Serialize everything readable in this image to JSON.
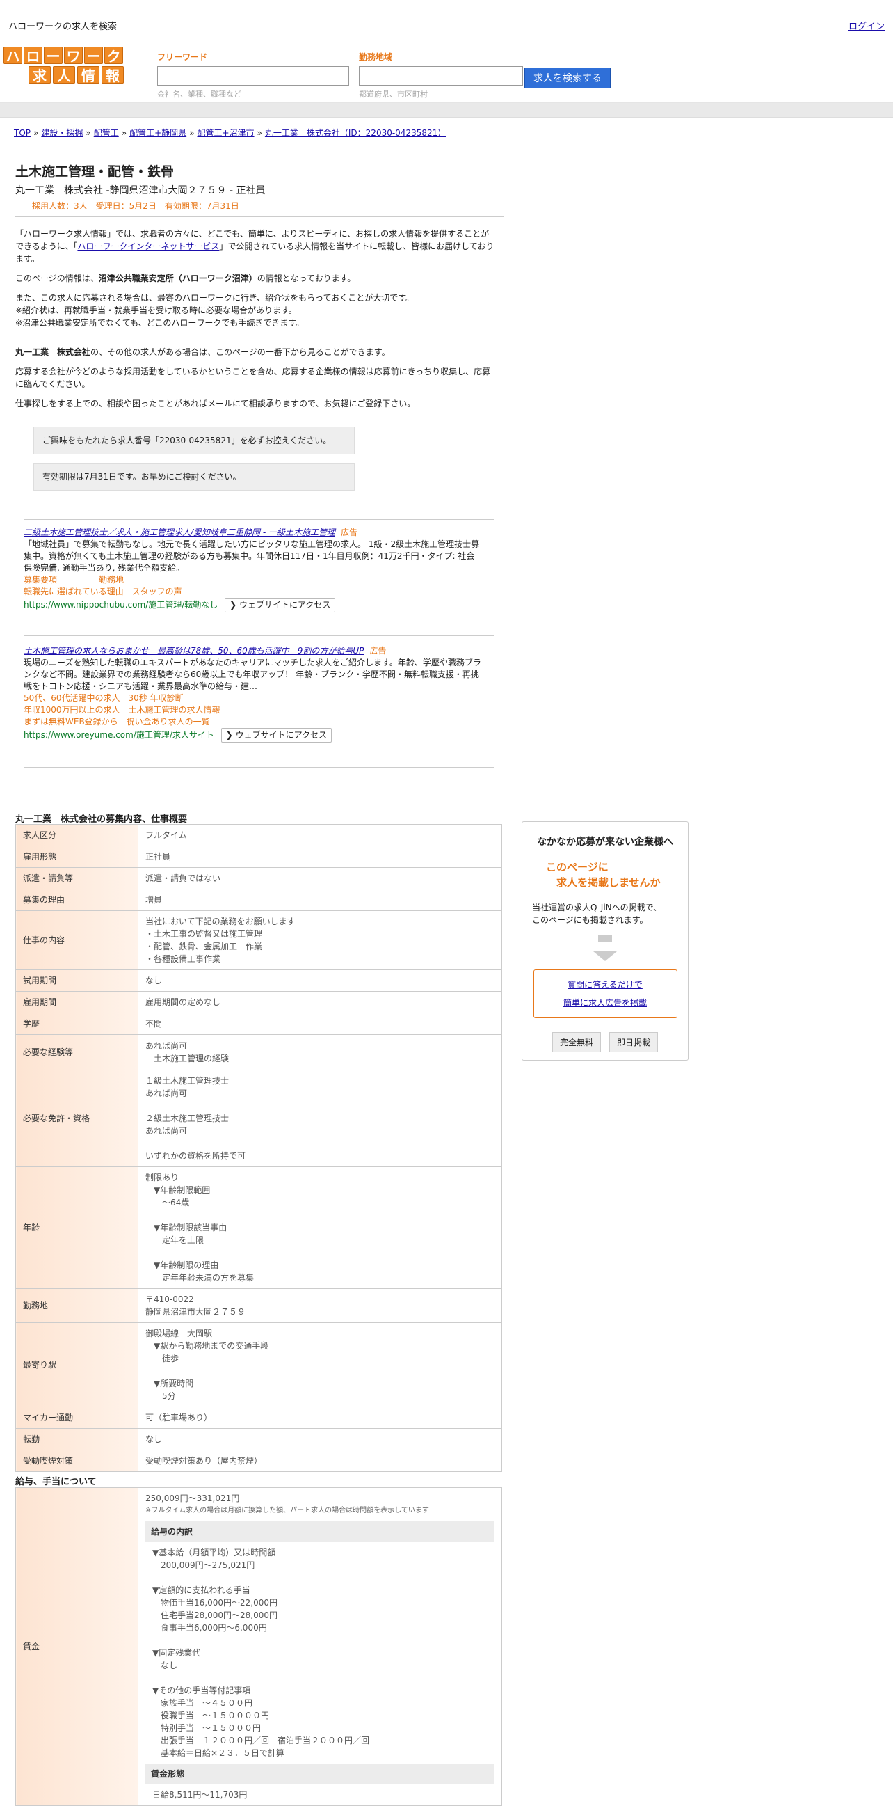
{
  "topbar": {
    "title": "ハローワークの求人を検索",
    "login": "ログイン"
  },
  "logo": {
    "row1": [
      "ハ",
      "ロ",
      "ー",
      "ワ",
      "ー",
      "ク"
    ],
    "row2": [
      "求",
      "人",
      "情",
      "報"
    ]
  },
  "search": {
    "free_label": "フリーワード",
    "free_placeholder": "会社名、業種、職種など",
    "area_label": "勤務地域",
    "area_placeholder": "都道府県、市区町村",
    "button": "求人を検索する"
  },
  "breadcrumb": [
    "TOP",
    "建設・採掘",
    "配管工",
    "配管工+静岡県",
    "配管工+沼津市",
    "丸一工業　株式会社（ID：22030-04235821）"
  ],
  "job": {
    "title": "土木施工管理・配管・鉄骨",
    "company_line": "丸一工業　株式会社 -静岡県沼津市大岡２７５９ - 正社員",
    "meta": "採用人数：3人　受理日：5月2日　有効期限：7月31日"
  },
  "intro": {
    "p1a": "「ハローワーク求人情報」では、求職者の方々に、どこでも、簡単に、よりスピーディに、お探しの求人情報を提供することができるように、「",
    "p1link": "ハローワークインターネットサービス",
    "p1b": "」で公開されている求人情報を当サイトに転載し、皆様にお届けしております。",
    "p2a": "このページの情報は、",
    "p2b": "沼津公共職業安定所（ハローワーク沼津）",
    "p2c": "の情報となっております。",
    "p3": "また、この求人に応募される場合は、最寄のハローワークに行き、紹介状をもらっておくことが大切です。",
    "p3b": "※紹介状は、再就職手当・就業手当を受け取る時に必要な場合があります。",
    "p3c": "※沼津公共職業安定所でなくても、どこのハローワークでも手続きできます。",
    "p4a": "丸一工業　株式会社",
    "p4b": "の、その他の求人がある場合は、このページの一番下から見ることができます。",
    "p5": "応募する会社が今どのような採用活動をしているかということを含め、応募する企業様の情報は応募前にきっちり収集し、応募に臨んでください。",
    "p6": "仕事探しをする上での、相談や困ったことがあればメールにて相談承りますので、お気軽にご登録下さい。",
    "notice1": "ご興味をもたれたら求人番号「22030-04235821」を必ずお控えください。",
    "notice2": "有効期限は7月31日です。お早めにご検討ください。"
  },
  "ads": [
    {
      "title": "二級土木施工管理技士／求人・施工管理求人/愛知岐阜三重静岡 - 一級土木施工管理",
      "label": "広告",
      "desc": "「地域社員」で募集で転勤もなし。地元で長く活躍したい方にピッタリな施工管理の求人。 1級・2級土木施工管理技士募集中。資格が無くても土木施工管理の経験がある方も募集中。年間休日117日・1年目月収例：41万2千円・タイプ: 社会保険完備, 通勤手当あり, 残業代全額支給。",
      "sitelinks1": "募集要項　　　　　勤務地",
      "sitelinks2": "転職先に選ばれている理由　スタッフの声",
      "url": "https://www.nippochubu.com/施工管理/転勤なし",
      "button": "ウェブサイトにアクセス"
    },
    {
      "title": "土木施工管理の求人ならおまかせ - 最高齢は78歳、50、60歳も活躍中 - 9割の方が給与UP",
      "label": "広告",
      "desc": "現場のニーズを熟知した転職のエキスパートがあなたのキャリアにマッチした求人をご紹介します。年齢、学歴や職務ブランクなど不問。建設業界での業務経験者なら60歳以上でも年収アップ！ 年齢・ブランク・学歴不問・無料転職支援・再挑戦をトコトン応援・シニアも活躍・業界最高水準の給与・建…",
      "sitelinks1": "50代、60代活躍中の求人　30秒 年収診断",
      "sitelinks2": "年収1000万円以上の求人　土木施工管理の求人情報",
      "sitelinks3": "まずは無料WEB登録から　祝い金あり求人の一覧",
      "url": "https://www.oreyume.com/施工管理/求人サイト",
      "button": "ウェブサイトにアクセス"
    }
  ],
  "section1_title": "丸一工業　株式会社の募集内容、仕事概要",
  "table1": [
    {
      "k": "求人区分",
      "v": [
        "フルタイム"
      ]
    },
    {
      "k": "雇用形態",
      "v": [
        "正社員"
      ]
    },
    {
      "k": "派遣・請負等",
      "v": [
        "派遣・請負ではない"
      ]
    },
    {
      "k": "募集の理由",
      "v": [
        "増員"
      ]
    },
    {
      "k": "仕事の内容",
      "v": [
        "当社において下記の業務をお願いします",
        "・土木工事の監督又は施工管理",
        "・配管、鉄骨、金属加工　作業",
        "・各種設備工事作業"
      ]
    },
    {
      "k": "試用期間",
      "v": [
        "なし"
      ]
    },
    {
      "k": "雇用期間",
      "v": [
        "雇用期間の定めなし"
      ]
    },
    {
      "k": "学歴",
      "v": [
        "不問"
      ]
    },
    {
      "k": "必要な経験等",
      "v": [
        "あれば尚可",
        "　土木施工管理の経験"
      ]
    },
    {
      "k": "必要な免許・資格",
      "v": [
        "１級土木施工管理技士",
        "あれば尚可",
        "",
        "２級土木施工管理技士",
        "あれば尚可",
        "",
        "いずれかの資格を所持で可"
      ]
    },
    {
      "k": "年齢",
      "v": [
        "制限あり",
        "　▼年齢制限範囲",
        "　　〜64歳",
        "",
        "　▼年齢制限該当事由",
        "　　定年を上限",
        "",
        "　▼年齢制限の理由",
        "　　定年年齢未満の方を募集"
      ]
    },
    {
      "k": "勤務地",
      "v": [
        "〒410-0022",
        "静岡県沼津市大岡２７５９"
      ]
    },
    {
      "k": "最寄り駅",
      "v": [
        "御殿場線　大岡駅",
        "　▼駅から勤務地までの交通手段",
        "　　徒歩",
        "",
        "　▼所要時間",
        "　　5分"
      ]
    },
    {
      "k": "マイカー通勤",
      "v": [
        "可（駐車場あり）"
      ]
    },
    {
      "k": "転勤",
      "v": [
        "なし"
      ]
    },
    {
      "k": "受動喫煙対策",
      "v": [
        "受動喫煙対策あり（屋内禁煙）"
      ]
    }
  ],
  "section2_title": "給与、手当について",
  "wage": {
    "key": "賃金",
    "range": "250,009円〜331,021円",
    "note": "※フルタイム求人の場合は月額に換算した額、パート求人の場合は時間額を表示しています",
    "sub1": "給与の内訳",
    "lines1": [
      "▼基本給（月額平均）又は時間額",
      "　200,009円〜275,021円",
      "",
      "▼定額的に支払われる手当",
      "　物価手当16,000円〜22,000円",
      "　住宅手当28,000円〜28,000円",
      "　食事手当6,000円〜6,000円",
      "",
      "▼固定残業代",
      "　なし",
      "",
      "▼その他の手当等付記事項",
      "　家族手当　〜４５００円",
      "　役職手当　〜１５００００円",
      "　特別手当　〜１５０００円",
      "　出張手当　１２０００円／回　宿泊手当２０００円／回",
      "　基本給＝日給×２３．５日で計算"
    ],
    "sub2": "賃金形態",
    "lines2": [
      "日給8,511円〜11,703円"
    ]
  },
  "sidebox": {
    "heading": "なかなか応募が来ない企業様へ",
    "catch1": "このページに",
    "catch2": "求人を掲載しませんか",
    "desc1": "当社運営の求人Q-JiNへの掲載で、",
    "desc2": "このページにも掲載されます。",
    "link1": "質問に答えるだけで",
    "link2": "簡単に求人広告を掲載",
    "tag1": "完全無料",
    "tag2": "即日掲載"
  }
}
